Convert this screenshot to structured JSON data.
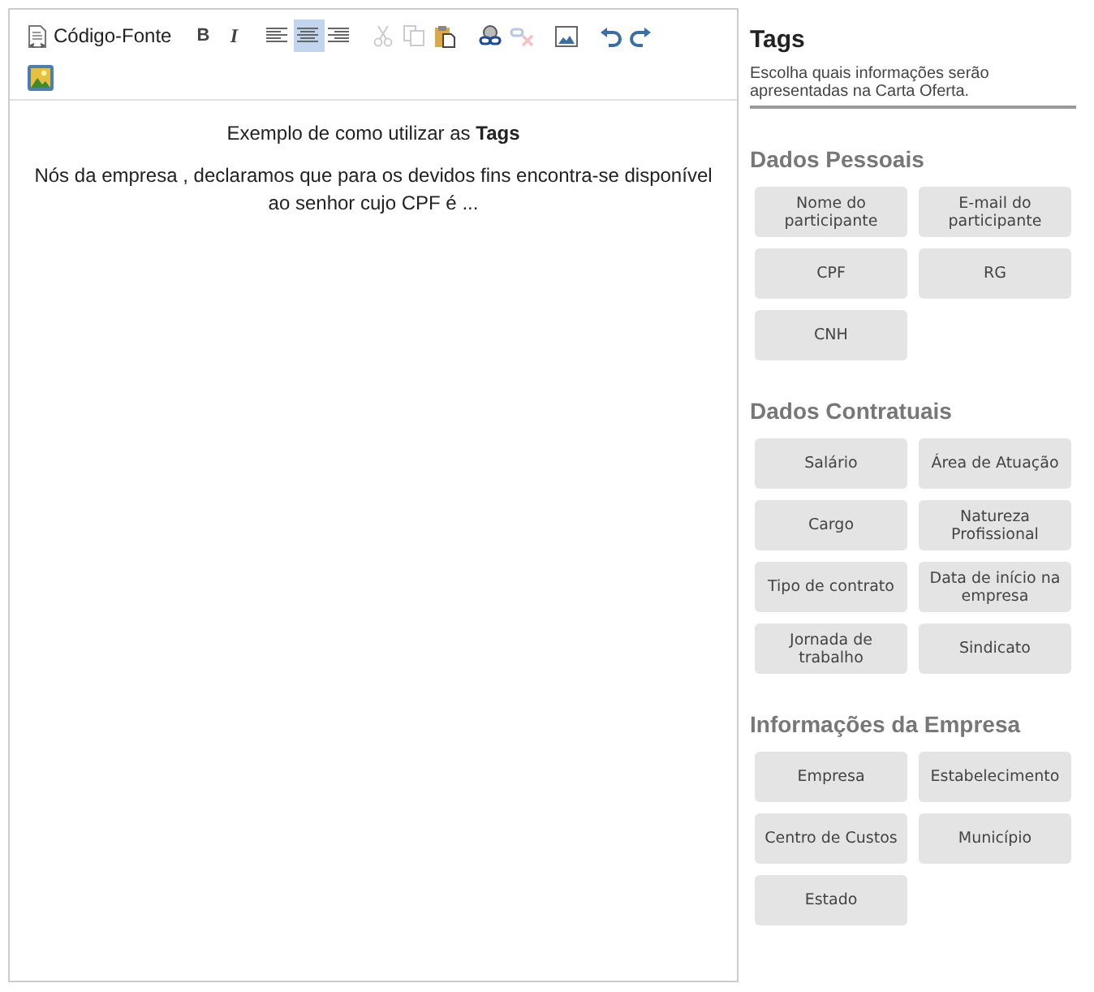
{
  "toolbar": {
    "buttons": [
      {
        "kind": "source",
        "label": "Código-Fonte",
        "disabled": false,
        "selected": false
      },
      {
        "kind": "bold",
        "label": "B",
        "disabled": false,
        "selected": false
      },
      {
        "kind": "italic",
        "label": "I",
        "disabled": false,
        "selected": false
      },
      {
        "kind": "alignleft",
        "disabled": false,
        "selected": false
      },
      {
        "kind": "aligncenter",
        "disabled": false,
        "selected": true
      },
      {
        "kind": "alignright",
        "disabled": false,
        "selected": false
      },
      {
        "kind": "cut",
        "disabled": true,
        "selected": false
      },
      {
        "kind": "copy",
        "disabled": true,
        "selected": false
      },
      {
        "kind": "paste",
        "disabled": false,
        "selected": false
      },
      {
        "kind": "link",
        "disabled": false,
        "selected": false
      },
      {
        "kind": "unlink",
        "disabled": true,
        "selected": false
      },
      {
        "kind": "image",
        "disabled": false,
        "selected": false
      },
      {
        "kind": "undo",
        "disabled": false,
        "selected": false
      },
      {
        "kind": "redo",
        "disabled": false,
        "selected": false
      },
      {
        "kind": "gallery",
        "disabled": false,
        "selected": false
      }
    ]
  },
  "editor": {
    "paragraphs": [
      "Exemplo de como utilizar as **Tags**",
      "Nós da empresa , declaramos que para os devidos fins encontra-se disponível ao senhor cujo CPF é ..."
    ]
  },
  "panel": {
    "title": "Tags",
    "description": "Escolha quais informações serão apresentadas na Carta Oferta.",
    "sections": [
      {
        "title": "Dados Pessoais",
        "tags": [
          "Nome do participante",
          "E-mail do participante",
          "CPF",
          "RG",
          "CNH"
        ]
      },
      {
        "title": "Dados Contratuais",
        "tags": [
          "Salário",
          "Área de Atuação",
          "Cargo",
          "Natureza Profissional",
          "Tipo de contrato",
          "Data de início na empresa",
          "Jornada de trabalho",
          "Sindicato"
        ]
      },
      {
        "title": "Informações da Empresa",
        "tags": [
          "Empresa",
          "Estabelecimento",
          "Centro de Custos",
          "Município",
          "Estado"
        ]
      }
    ]
  }
}
